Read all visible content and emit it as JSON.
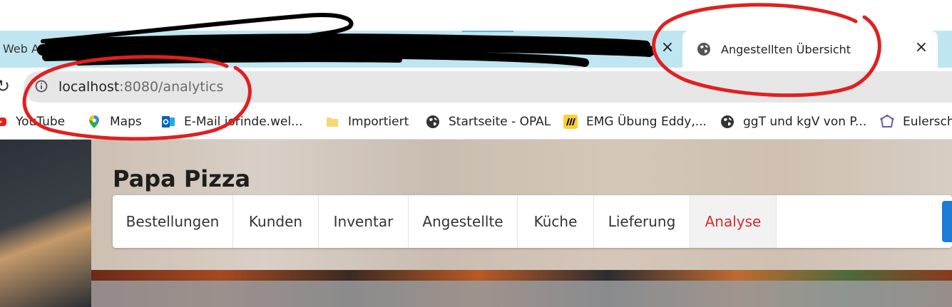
{
  "browser": {
    "tabs": [
      {
        "title": "Web A",
        "active": false
      },
      {
        "title": "Angestellten Übersicht",
        "active": true
      }
    ],
    "tab_close_glyph": "×",
    "address_bar": {
      "host": "localhost",
      "port_path": ":8080/analytics"
    },
    "bookmarks": [
      {
        "label": "YouTube",
        "icon": "youtube-icon"
      },
      {
        "label": "Maps",
        "icon": "maps-pin-icon"
      },
      {
        "label": "E-Mail jorinde.wel...",
        "icon": "outlook-icon"
      },
      {
        "label": "Importiert",
        "icon": "folder-icon"
      },
      {
        "label": "Startseite - OPAL",
        "icon": "globe-icon"
      },
      {
        "label": "EMG Übung Eddy,...",
        "icon": "miro-icon"
      },
      {
        "label": "ggT und kgV von P...",
        "icon": "globe-icon"
      },
      {
        "label": "Eulersch",
        "icon": "polygon-icon"
      }
    ]
  },
  "app": {
    "brand": "Papa Pizza",
    "nav": [
      {
        "label": "Bestellungen",
        "active": false
      },
      {
        "label": "Kunden",
        "active": false
      },
      {
        "label": "Inventar",
        "active": false
      },
      {
        "label": "Angestellte",
        "active": false
      },
      {
        "label": "Küche",
        "active": false
      },
      {
        "label": "Lieferung",
        "active": false
      },
      {
        "label": "Analyse",
        "active": true
      }
    ]
  },
  "colors": {
    "tabstrip": "#bfe6f0",
    "nav_active_text": "#d62b2b",
    "annotation_red": "#e02020",
    "scribble": "#000000",
    "button_blue": "#1e7bd6"
  }
}
